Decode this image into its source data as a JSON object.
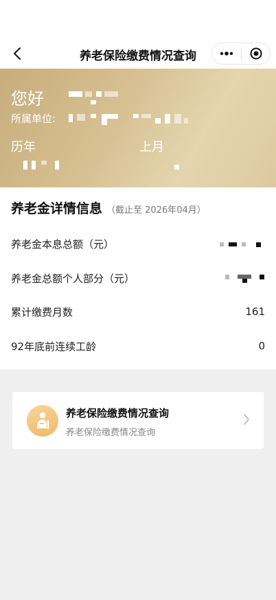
{
  "navbar": {
    "title": "养老保险缴费情况查询",
    "back_icon": "chevron-left-icon",
    "more_icon": "more-dots-icon",
    "close_icon": "target-close-icon"
  },
  "banner": {
    "greeting": "您好",
    "unit_label": "所属单位:",
    "history_label": "历年",
    "last_month_label": "上月"
  },
  "detail": {
    "title": "养老金详情信息",
    "subtitle": "（截止至 2026年04月）",
    "rows": [
      {
        "label": "养老金本息总额（元）",
        "value": ""
      },
      {
        "label": "养老金总额个人部分（元）",
        "value": ""
      },
      {
        "label": "累计缴费月数",
        "value": "161"
      },
      {
        "label": "92年底前连续工龄",
        "value": "0"
      }
    ]
  },
  "card": {
    "title": "养老保险缴费情况查询",
    "subtitle": "养老保险缴费情况查询",
    "icon": "elderly-person-icon",
    "chevron_icon": "chevron-right-icon"
  },
  "colors": {
    "banner_gold": "#d6bf91",
    "card_icon_orange": "#efb86a",
    "page_bg": "#efefef"
  }
}
